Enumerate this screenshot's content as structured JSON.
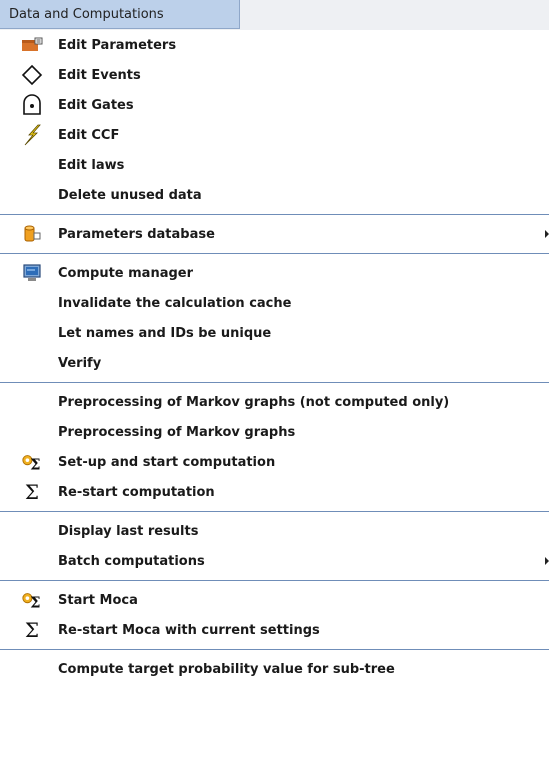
{
  "menu": {
    "title": "Data and Computations"
  },
  "items": {
    "edit_parameters": "Edit Parameters",
    "edit_events": "Edit Events",
    "edit_gates": "Edit Gates",
    "edit_ccf": "Edit CCF",
    "edit_laws": "Edit laws",
    "delete_unused": "Delete unused data",
    "parameters_db": "Parameters database",
    "compute_manager": "Compute manager",
    "invalidate_cache": "Invalidate the calculation cache",
    "unique_names": "Let names and IDs be unique",
    "verify": "Verify",
    "preprocess_not_computed": "Preprocessing of Markov graphs (not computed only)",
    "preprocess": "Preprocessing of Markov graphs",
    "setup_start": "Set-up and start computation",
    "restart_computation": "Re-start computation",
    "display_results": "Display last results",
    "batch": "Batch computations",
    "start_moca": "Start Moca",
    "restart_moca": "Re-start Moca with current settings",
    "compute_target": "Compute target probability value for sub-tree"
  },
  "icons": {
    "edit_parameters": "folder-icon",
    "edit_events": "diamond-icon",
    "edit_gates": "gate-icon",
    "edit_ccf": "lightning-icon",
    "parameters_db": "database-icon",
    "compute_manager": "monitor-icon",
    "setup_start": "gear-sigma-icon",
    "restart_computation": "sigma-icon",
    "start_moca": "gear-sigma-icon",
    "restart_moca": "sigma-icon"
  },
  "colors": {
    "menu_title_bg": "#bcd0ea",
    "separator": "#6f8db8",
    "accent_orange": "#e07a1c"
  }
}
